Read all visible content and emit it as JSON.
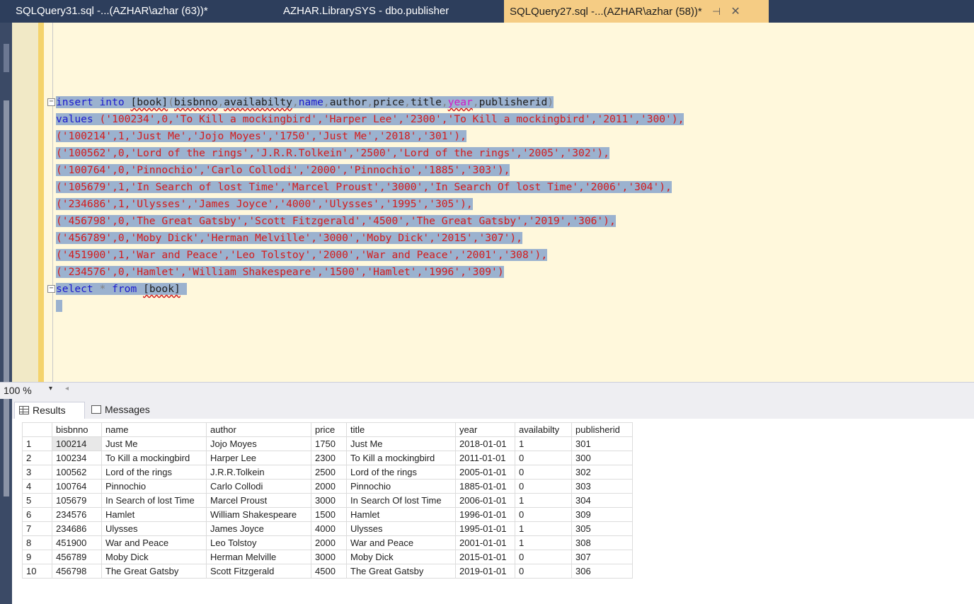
{
  "tabs": [
    {
      "label": "SQLQuery31.sql -...(AZHAR\\azhar (63))*"
    },
    {
      "label": "AZHAR.LibrarySYS - dbo.publisher"
    },
    {
      "label": "SQLQuery27.sql -...(AZHAR\\azhar (58))*"
    }
  ],
  "tab_icons": {
    "pin": "⊣",
    "close": "✕"
  },
  "editor": {
    "line1": {
      "insert": "insert",
      "into": "into",
      "table": "[book]",
      "open": "(",
      "c1": "bisbnno",
      "c2": "availabilty",
      "c3": "name",
      "c4": "author",
      "c5": "price",
      "c6": "title",
      "c7": "year",
      "c8": "publisherid",
      "close": ")"
    },
    "values_kw": "values",
    "rows": [
      "('100234',0,'To Kill a mockingbird','Harper Lee','2300','To Kill a mockingbird','2011','300'),",
      "('100214',1,'Just Me','Jojo Moyes','1750','Just Me','2018','301'),",
      "('100562',0,'Lord of the rings','J.R.R.Tolkein','2500','Lord of the rings','2005','302'),",
      "('100764',0,'Pinnochio','Carlo Collodi','2000','Pinnochio','1885','303'),",
      "('105679',1,'In Search of lost Time','Marcel Proust','3000','In Search Of lost Time','2006','304'),",
      "('234686',1,'Ulysses','James Joyce','4000','Ulysses','1995','305'),",
      "('456798',0,'The Great Gatsby','Scott Fitzgerald','4500','The Great Gatsby','2019','306'),",
      "('456789',0,'Moby Dick','Herman Melville','3000','Moby Dick','2015','307'),",
      "('451900',1,'War and Peace','Leo Tolstoy','2000','War and Peace','2001','308'),",
      "('234576',0,'Hamlet','William Shakespeare','1500','Hamlet','1996','309')"
    ],
    "select_line": {
      "select": "select",
      "star": "*",
      "from": "from",
      "table": "[book]"
    }
  },
  "zoom": {
    "value": "100 %",
    "arrow": "▾",
    "scroll": "◂"
  },
  "results_tabs": {
    "results": "Results",
    "messages": "Messages"
  },
  "grid": {
    "columns": [
      "",
      "bisbnno",
      "name",
      "author",
      "price",
      "title",
      "year",
      "availabilty",
      "publisherid"
    ],
    "rows": [
      [
        "1",
        "100214",
        "Just Me",
        "Jojo Moyes",
        "1750",
        "Just Me",
        "2018-01-01",
        "1",
        "301"
      ],
      [
        "2",
        "100234",
        "To Kill a mockingbird",
        "Harper Lee",
        "2300",
        "To Kill a mockingbird",
        "2011-01-01",
        "0",
        "300"
      ],
      [
        "3",
        "100562",
        "Lord of the rings",
        "J.R.R.Tolkein",
        "2500",
        "Lord of the rings",
        "2005-01-01",
        "0",
        "302"
      ],
      [
        "4",
        "100764",
        "Pinnochio",
        "Carlo Collodi",
        "2000",
        "Pinnochio",
        "1885-01-01",
        "0",
        "303"
      ],
      [
        "5",
        "105679",
        "In Search of lost Time",
        "Marcel Proust",
        "3000",
        "In Search Of lost Time",
        "2006-01-01",
        "1",
        "304"
      ],
      [
        "6",
        "234576",
        "Hamlet",
        "William Shakespeare",
        "1500",
        "Hamlet",
        "1996-01-01",
        "0",
        "309"
      ],
      [
        "7",
        "234686",
        "Ulysses",
        "James Joyce",
        "4000",
        "Ulysses",
        "1995-01-01",
        "1",
        "305"
      ],
      [
        "8",
        "451900",
        "War and Peace",
        "Leo Tolstoy",
        "2000",
        "War and Peace",
        "2001-01-01",
        "1",
        "308"
      ],
      [
        "9",
        "456789",
        "Moby Dick",
        "Herman Melville",
        "3000",
        "Moby Dick",
        "2015-01-01",
        "0",
        "307"
      ],
      [
        "10",
        "456798",
        "The Great Gatsby",
        "Scott Fitzgerald",
        "4500",
        "The Great Gatsby",
        "2019-01-01",
        "0",
        "306"
      ]
    ]
  }
}
